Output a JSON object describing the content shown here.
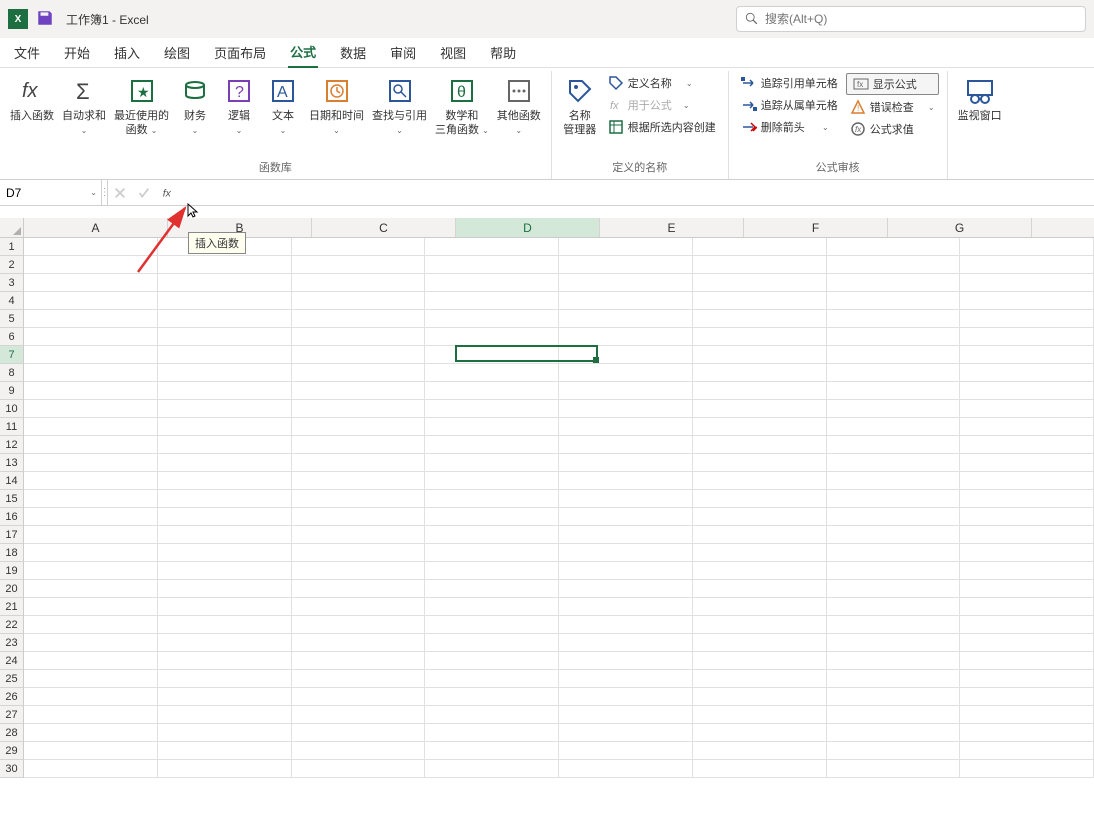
{
  "title_bar": {
    "workbook_name": "工作簿1",
    "dash": "  -  ",
    "app_name": "Excel",
    "search_placeholder": "搜索(Alt+Q)"
  },
  "tabs": {
    "file": "文件",
    "home": "开始",
    "insert": "插入",
    "draw": "绘图",
    "layout": "页面布局",
    "formula": "公式",
    "data": "数据",
    "review": "审阅",
    "view": "视图",
    "help": "帮助"
  },
  "ribbon": {
    "insert_fn": "插入函数",
    "autosum": "自动求和",
    "recent": "最近使用的\n函数",
    "financial": "财务",
    "logical": "逻辑",
    "text": "文本",
    "datetime": "日期和时间",
    "lookup": "查找与引用",
    "math": "数学和\n三角函数",
    "other": "其他函数",
    "name_mgr": "名称\n管理器",
    "define_name": "定义名称",
    "use_formula": "用于公式",
    "create_from": "根据所选内容创建",
    "trace_prec": "追踪引用单元格",
    "trace_dep": "追踪从属单元格",
    "remove_arrows": "删除箭头",
    "show_formulas": "显示公式",
    "error_check": "错误检查",
    "evaluate": "公式求值",
    "watch": "监视窗口",
    "group_fn_lib": "函数库",
    "group_names": "定义的名称",
    "group_audit": "公式审核"
  },
  "formula_bar": {
    "name_box": "D7",
    "fx_tooltip": "插入函数"
  },
  "grid": {
    "cols": [
      "A",
      "B",
      "C",
      "D",
      "E",
      "F",
      "G"
    ],
    "rows": 30,
    "active_col": 3,
    "active_row": 6
  }
}
